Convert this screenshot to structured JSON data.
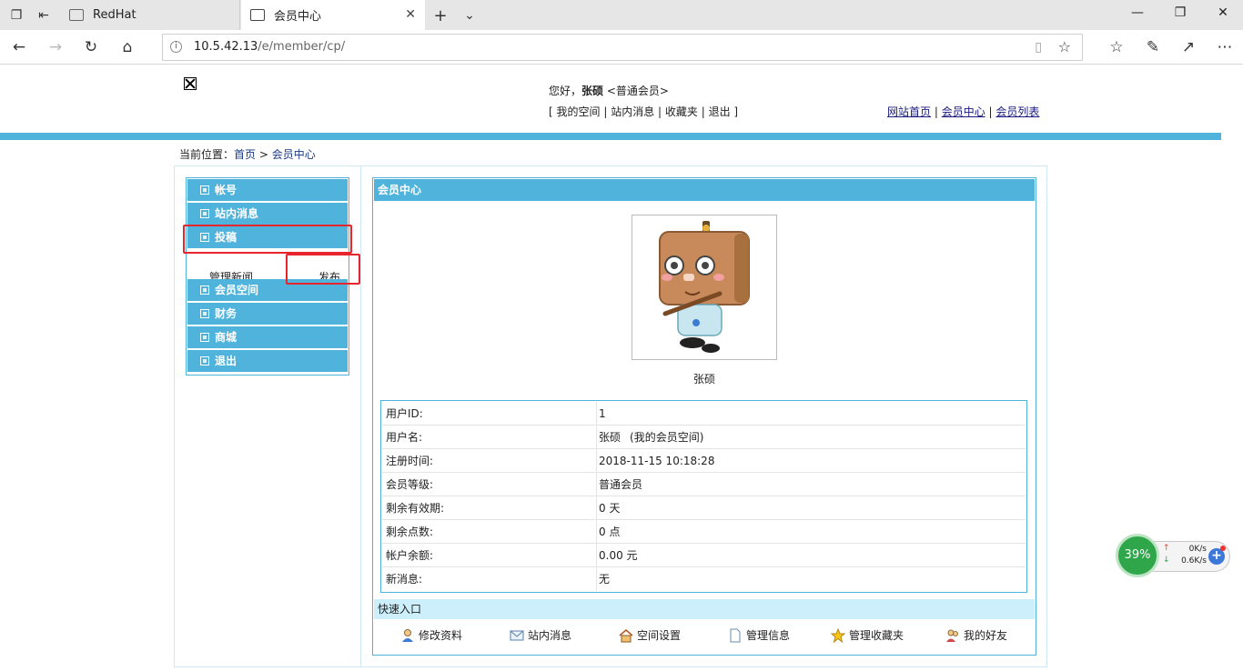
{
  "browser": {
    "tabs": [
      {
        "label": "RedHat",
        "active": false
      },
      {
        "label": "会员中心",
        "active": true
      }
    ],
    "new_tab": "+",
    "address": {
      "host": "10.5.42.13",
      "path": "/e/member/cp/"
    }
  },
  "header": {
    "greeting_prefix": "您好，",
    "username": "张硕",
    "level": "<普通会员>",
    "member_links": [
      "我的空间",
      "站内消息",
      "收藏夹",
      "退出"
    ],
    "site_links": [
      "网站首页",
      "会员中心",
      "会员列表"
    ]
  },
  "breadcrumb": {
    "label": "当前位置：",
    "home": "首页",
    "sep": " > ",
    "current": "会员中心"
  },
  "sidebar": {
    "items": [
      {
        "label": "帐号"
      },
      {
        "label": "站内消息"
      },
      {
        "label": "投稿"
      },
      {
        "label": "会员空间"
      },
      {
        "label": "财务"
      },
      {
        "label": "商城"
      },
      {
        "label": "退出"
      }
    ],
    "sub_items": [
      "管理新闻",
      "发布"
    ]
  },
  "main": {
    "title": "会员中心",
    "avatar_name": "张硕",
    "rows": [
      {
        "key": "用户ID:",
        "value": "1"
      },
      {
        "key": "用户名:",
        "value": "张硕",
        "extra": "(我的会员空间)"
      },
      {
        "key": "注册时间:",
        "value": "2018-11-15 10:18:28"
      },
      {
        "key": "会员等级:",
        "value": "普通会员"
      },
      {
        "key": "剩余有效期:",
        "value": "0 天"
      },
      {
        "key": "剩余点数:",
        "value": "0 点"
      },
      {
        "key": "帐户余额:",
        "value": "0.00 元"
      },
      {
        "key": "新消息:",
        "value": "无"
      }
    ],
    "quick_title": "快速入口",
    "quick_links": [
      "修改资料",
      "站内消息",
      "空间设置",
      "管理信息",
      "管理收藏夹",
      "我的好友"
    ]
  },
  "widget": {
    "percent": "39%",
    "up": "0K/s",
    "down": "0.6K/s"
  },
  "colors": {
    "accent": "#4fb3dc",
    "highlight": "#e8252c",
    "quick_bg": "#cdeefb"
  }
}
